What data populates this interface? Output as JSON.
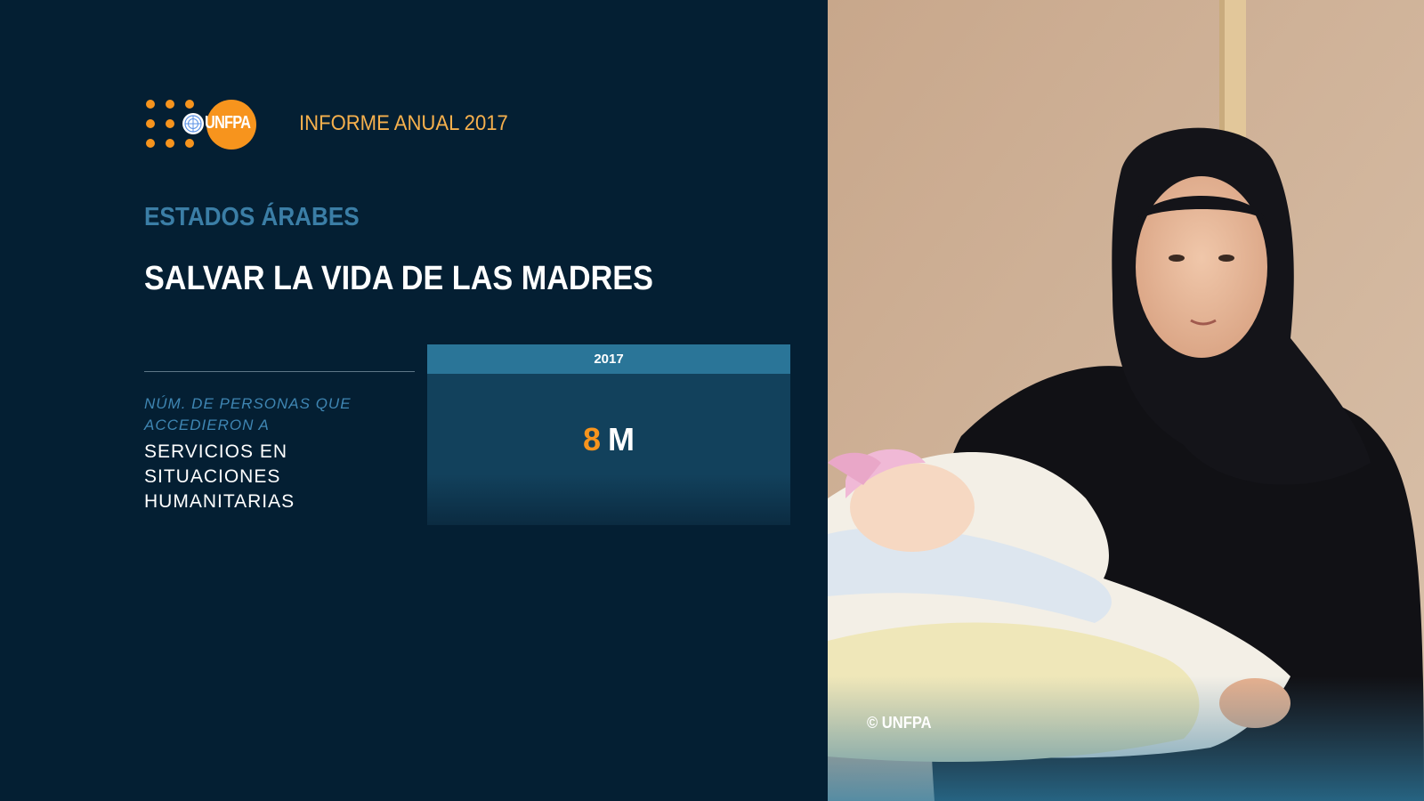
{
  "header": {
    "logo_text": "UNFPA",
    "report_title": "INFORME ANUAL 2017"
  },
  "region": "ESTADOS ÁRABES",
  "headline": "SALVAR LA VIDA DE LAS MADRES",
  "indicator": {
    "caption": "NÚM. DE PERSONAS QUE ACCEDIERON A",
    "label": "SERVICIOS EN SITUACIONES HUMANITARIAS"
  },
  "stat": {
    "year": "2017",
    "number": "8",
    "unit": "M"
  },
  "photo": {
    "credit": "© UNFPA"
  },
  "colors": {
    "background": "#041f33",
    "accent_orange": "#f7941d",
    "region_blue": "#3b7ea6",
    "stat_header": "#2a7598",
    "report_title": "#f6b04d"
  }
}
